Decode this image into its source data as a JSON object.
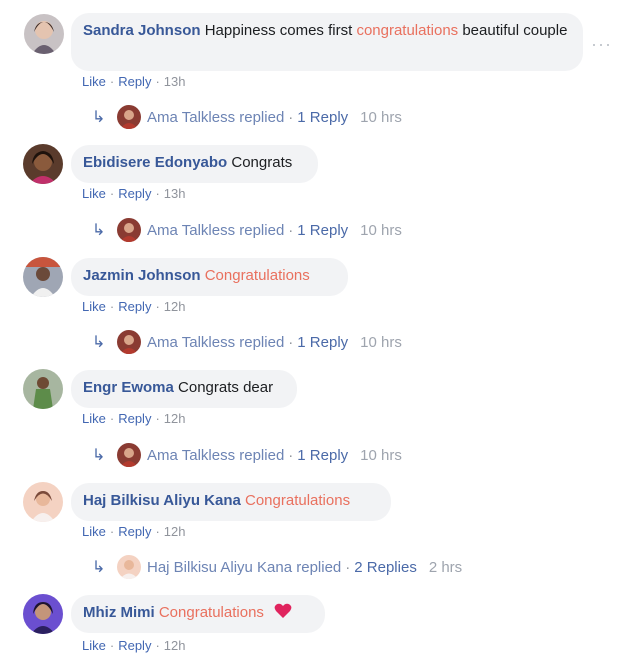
{
  "comments": [
    {
      "author": "Sandra Johnson",
      "text": "Happiness comes first",
      "highlight": "congratulations",
      "tail": "beautiful couple",
      "time": "13h",
      "reply": {
        "name": "Ama Talkless replied",
        "count": "1 Reply",
        "time": "10 hrs"
      }
    },
    {
      "author": "Ebidisere Edonyabo",
      "text": "Congrats",
      "time": "13h",
      "reply": {
        "name": "Ama Talkless replied",
        "count": "1 Reply",
        "time": "10 hrs"
      }
    },
    {
      "author": "Jazmin Johnson",
      "highlight": "Congratulations",
      "time": "12h",
      "reply": {
        "name": "Ama Talkless replied",
        "count": "1 Reply",
        "time": "10 hrs"
      }
    },
    {
      "author": "Engr Ewoma",
      "text": "Congrats dear",
      "time": "12h",
      "reply": {
        "name": "Ama Talkless replied",
        "count": "1 Reply",
        "time": "10 hrs"
      }
    },
    {
      "author": "Haj Bilkisu Aliyu Kana",
      "highlight": "Congratulations",
      "time": "12h",
      "reply": {
        "name": "Haj Bilkisu Aliyu Kana replied",
        "count": "2 Replies",
        "time": "2 hrs"
      }
    },
    {
      "author": "Mhiz Mimi",
      "highlight": "Congratulations",
      "time": "12h"
    }
  ],
  "labels": {
    "like": "Like",
    "reply": "Reply",
    "dot": "·",
    "more": "···",
    "arrow": "↳"
  },
  "colors": {
    "author": "#385898",
    "highlight": "#e9705e",
    "bubble": "#f2f3f5",
    "link": "#4267b2",
    "meta": "#90949c",
    "heart": "#e0245e"
  },
  "icons": {
    "more": "more-options-icon",
    "reply_arrow": "reply-arrow-icon",
    "heart": "heart-emoji-icon"
  }
}
